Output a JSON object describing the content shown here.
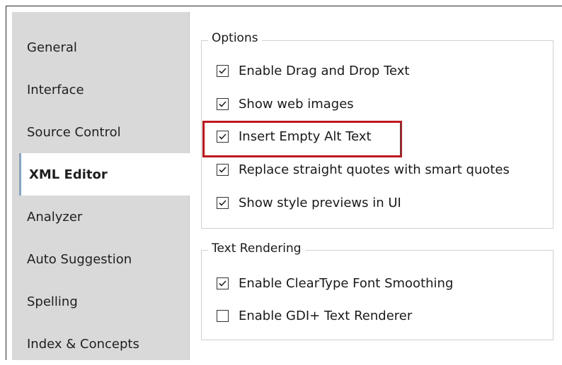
{
  "sidebar": {
    "items": [
      {
        "label": "General",
        "active": false
      },
      {
        "label": "Interface",
        "active": false
      },
      {
        "label": "Source Control",
        "active": false
      },
      {
        "label": "XML Editor",
        "active": true
      },
      {
        "label": "Analyzer",
        "active": false
      },
      {
        "label": "Auto Suggestion",
        "active": false
      },
      {
        "label": "Spelling",
        "active": false
      },
      {
        "label": "Index & Concepts",
        "active": false
      }
    ]
  },
  "options_group": {
    "title": "Options",
    "items": [
      {
        "label": "Enable Drag and Drop Text",
        "checked": true
      },
      {
        "label": "Show web images",
        "checked": true
      },
      {
        "label": "Insert Empty Alt Text",
        "checked": true,
        "highlighted": true
      },
      {
        "label": "Replace straight quotes with smart quotes",
        "checked": true
      },
      {
        "label": "Show style previews in UI",
        "checked": true
      }
    ]
  },
  "text_rendering_group": {
    "title": "Text Rendering",
    "items": [
      {
        "label": "Enable ClearType Font Smoothing",
        "checked": true
      },
      {
        "label": "Enable GDI+ Text Renderer",
        "checked": false
      }
    ]
  },
  "colors": {
    "highlight": "#c0181f",
    "active_accent": "#7aa7d4"
  }
}
